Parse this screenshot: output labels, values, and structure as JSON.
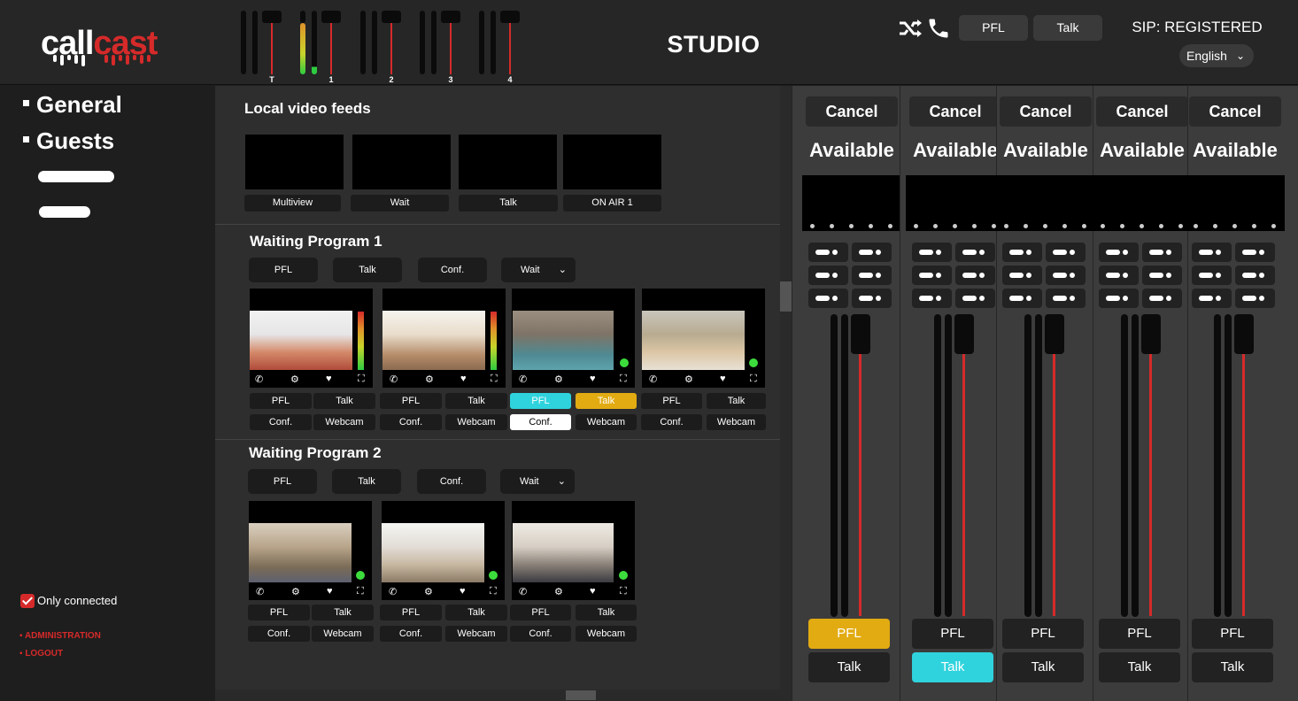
{
  "header": {
    "logo_part1": "call",
    "logo_part2": "cast",
    "title": "STUDIO",
    "meters": [
      "T",
      "1",
      "2",
      "3",
      "4"
    ],
    "pfl_label": "PFL",
    "talk_label": "Talk",
    "sip_status": "SIP: REGISTERED",
    "language": "English",
    "icons": [
      "shuffle-icon",
      "phone-icon"
    ]
  },
  "sidebar": {
    "items": [
      {
        "label": "General"
      },
      {
        "label": "Guests"
      }
    ],
    "only_connected_label": "Only connected",
    "only_connected_checked": true,
    "links": [
      {
        "label": "ADMINISTRATION"
      },
      {
        "label": "LOGOUT"
      }
    ]
  },
  "main": {
    "local_feeds_title": "Local video feeds",
    "local_feeds": [
      {
        "label": "Multiview"
      },
      {
        "label": "Wait"
      },
      {
        "label": "Talk"
      },
      {
        "label": "ON AIR 1"
      }
    ],
    "programs": [
      {
        "title": "Waiting Program 1",
        "controls": {
          "pfl": "PFL",
          "talk": "Talk",
          "conf": "Conf.",
          "mode": "Wait"
        },
        "guests": [
          {
            "pfl": "PFL",
            "talk": "Talk",
            "conf": "Conf.",
            "webcam": "Webcam",
            "level": 0.85,
            "state": "meter"
          },
          {
            "pfl": "PFL",
            "talk": "Talk",
            "conf": "Conf.",
            "webcam": "Webcam",
            "level": 0.85,
            "state": "meter"
          },
          {
            "pfl": "PFL",
            "talk": "Talk",
            "conf": "Conf.",
            "webcam": "Webcam",
            "state": "connected",
            "pfl_active": true,
            "talk_active": true,
            "conf_active": true
          },
          {
            "pfl": "PFL",
            "talk": "Talk",
            "conf": "Conf.",
            "webcam": "Webcam",
            "state": "connected"
          }
        ]
      },
      {
        "title": "Waiting Program 2",
        "controls": {
          "pfl": "PFL",
          "talk": "Talk",
          "conf": "Conf.",
          "mode": "Wait"
        },
        "guests": [
          {
            "pfl": "PFL",
            "talk": "Talk",
            "conf": "Conf.",
            "webcam": "Webcam",
            "state": "connected"
          },
          {
            "pfl": "PFL",
            "talk": "Talk",
            "conf": "Conf.",
            "webcam": "Webcam",
            "state": "connected"
          },
          {
            "pfl": "PFL",
            "talk": "Talk",
            "conf": "Conf.",
            "webcam": "Webcam",
            "state": "connected"
          }
        ]
      }
    ]
  },
  "mixer": {
    "channels": [
      {
        "cancel": "Cancel",
        "status": "Available",
        "pfl": "PFL",
        "talk": "Talk",
        "pfl_active": true,
        "talk_active": false
      },
      {
        "cancel": "Cancel",
        "status": "Available",
        "pfl": "PFL",
        "talk": "Talk",
        "pfl_active": false,
        "talk_active": true
      },
      {
        "cancel": "Cancel",
        "status": "Available",
        "pfl": "PFL",
        "talk": "Talk",
        "pfl_active": false,
        "talk_active": false
      },
      {
        "cancel": "Cancel",
        "status": "Available",
        "pfl": "PFL",
        "talk": "Talk",
        "pfl_active": false,
        "talk_active": false
      },
      {
        "cancel": "Cancel",
        "status": "Available",
        "pfl": "PFL",
        "talk": "Talk",
        "pfl_active": false,
        "talk_active": false
      }
    ]
  },
  "colors": {
    "accent_red": "#d62a2a",
    "active_yellow": "#e2ab12",
    "active_cyan": "#2fd3dd",
    "online_green": "#3ddc3d"
  }
}
